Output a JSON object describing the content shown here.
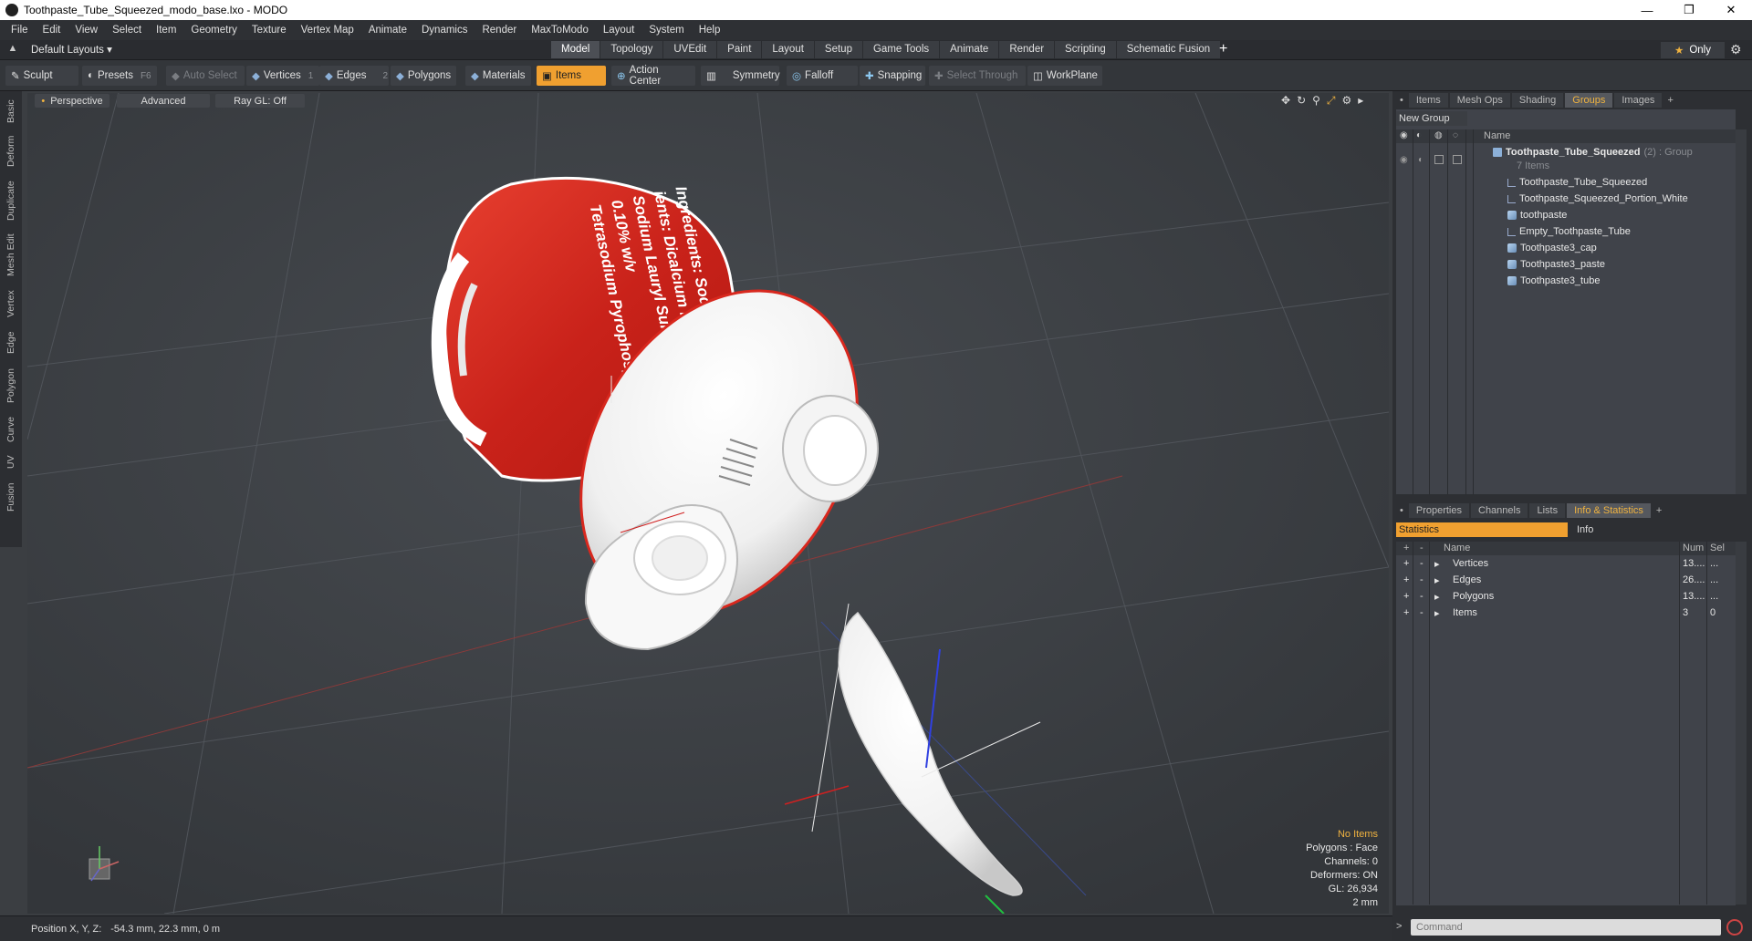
{
  "window": {
    "title": "Toothpaste_Tube_Squeezed_modo_base.lxo - MODO",
    "controls": [
      "—",
      "❐",
      "✕"
    ]
  },
  "menu": [
    "File",
    "Edit",
    "View",
    "Select",
    "Item",
    "Geometry",
    "Texture",
    "Vertex Map",
    "Animate",
    "Dynamics",
    "Render",
    "MaxToModo",
    "Layout",
    "System",
    "Help"
  ],
  "layout": {
    "selector": "Default Layouts ▾",
    "tabs": [
      "Model",
      "Topology",
      "UVEdit",
      "Paint",
      "Layout",
      "Setup",
      "Game Tools",
      "Animate",
      "Render",
      "Scripting",
      "Schematic Fusion"
    ],
    "active": "Model",
    "add": "+",
    "only": "Only"
  },
  "toolbar": {
    "sculpt": "Sculpt",
    "presets": "Presets",
    "presets_key": "F6",
    "auto_select": "Auto Select",
    "vertices": "Vertices",
    "vertices_num": "1",
    "edges": "Edges",
    "edges_num": "2",
    "polygons": "Polygons",
    "materials": "Materials",
    "items": "Items",
    "action_center": "Action Center",
    "symmetry": "Symmetry",
    "falloff": "Falloff",
    "snapping": "Snapping",
    "select_through": "Select Through",
    "workplane": "WorkPlane"
  },
  "left_tabs": [
    "Basic",
    "Deform",
    "Duplicate",
    "Mesh Edit",
    "Vertex",
    "Edge",
    "Polygon",
    "Curve",
    "UV",
    "Fusion"
  ],
  "viewport": {
    "view": "Perspective",
    "shading": "Advanced",
    "raygl": "Ray GL: Off",
    "stats": {
      "items": "No Items",
      "polygons": "Polygons : Face",
      "channels": "Channels: 0",
      "deformers": "Deformers: ON",
      "gl": "GL: 26,934",
      "scale": "2 mm"
    },
    "label_lines": [
      "Ingredients: Sodium Fl",
      "ients: Dicalcium Ph",
      "Sodium Lauryl Sulfate, F",
      "0.10% w/v",
      "Tetrasodium Pyrophosph"
    ]
  },
  "status": {
    "label": "Position X, Y, Z:",
    "value": "-54.3 mm, 22.3 mm, 0 m"
  },
  "groups_panel": {
    "tabs": [
      "Items",
      "Mesh Ops",
      "Shading",
      "Groups",
      "Images"
    ],
    "active": "Groups",
    "new_group": "New Group",
    "col_name": "Name",
    "root": {
      "name": "Toothpaste_Tube_Squeezed",
      "detail": "(2) : Group",
      "count": "7 Items"
    },
    "children": [
      {
        "name": "Toothpaste_Tube_Squeezed",
        "icon": "locator-icon"
      },
      {
        "name": "Toothpaste_Squeezed_Portion_White",
        "icon": "locator-icon"
      },
      {
        "name": "toothpaste",
        "icon": "mesh-icon"
      },
      {
        "name": "Empty_Toothpaste_Tube",
        "icon": "locator-icon"
      },
      {
        "name": "Toothpaste3_cap",
        "icon": "mesh-icon"
      },
      {
        "name": "Toothpaste3_paste",
        "icon": "mesh-icon"
      },
      {
        "name": "Toothpaste3_tube",
        "icon": "mesh-icon"
      }
    ]
  },
  "props_panel": {
    "tabs": [
      "Properties",
      "Channels",
      "Lists",
      "Info & Statistics"
    ],
    "active": "Info & Statistics",
    "subtabs": [
      "Statistics",
      "Info"
    ],
    "columns": [
      "Name",
      "Num",
      "Sel"
    ],
    "rows": [
      {
        "name": "Vertices",
        "num": "13....",
        "sel": "..."
      },
      {
        "name": "Edges",
        "num": "26....",
        "sel": "..."
      },
      {
        "name": "Polygons",
        "num": "13....",
        "sel": "..."
      },
      {
        "name": "Items",
        "num": "3",
        "sel": "0"
      }
    ]
  },
  "command": {
    "placeholder": "Command",
    "prompt": ">"
  },
  "colors": {
    "accent": "#f0a030",
    "tube_red": "#d8281e",
    "bg": "#3b3f43"
  }
}
